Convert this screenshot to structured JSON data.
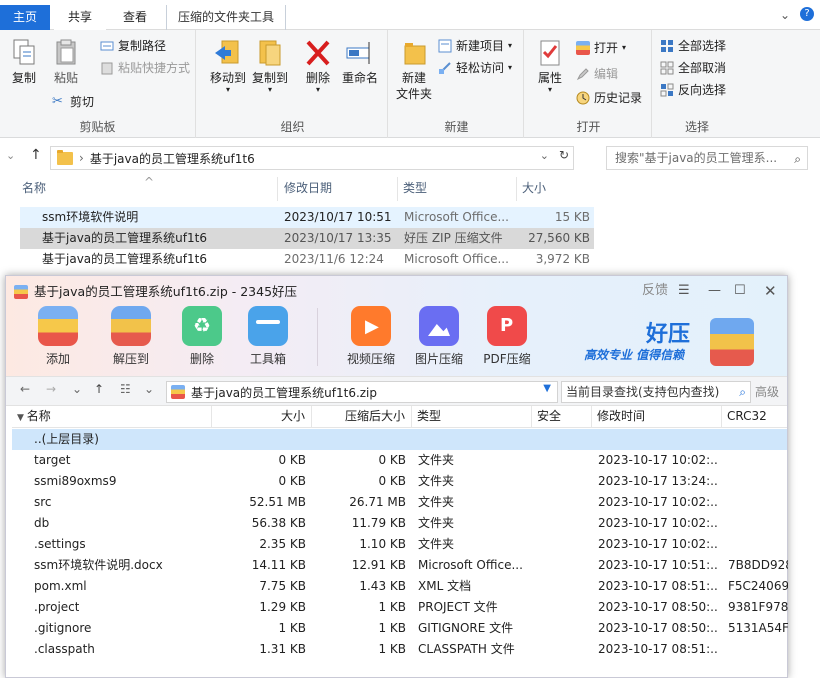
{
  "explorer": {
    "tabs": [
      "主页",
      "共享",
      "查看",
      "压缩的文件夹工具"
    ],
    "clipboard": {
      "copy": "复制",
      "paste": "粘贴",
      "copy_path": "复制路径",
      "paste_shortcut": "粘贴快捷方式",
      "cut": "剪切",
      "group": "剪贴板"
    },
    "organize": {
      "move_to": "移动到",
      "copy_to": "复制到",
      "delete": "删除",
      "rename": "重命名",
      "group": "组织"
    },
    "new": {
      "new_folder_1": "新建",
      "new_folder_2": "文件夹",
      "new_item": "新建项目",
      "easy_access": "轻松访问",
      "group": "新建"
    },
    "open": {
      "properties": "属性",
      "open": "打开",
      "edit": "编辑",
      "history": "历史记录",
      "group": "打开"
    },
    "select": {
      "select_all": "全部选择",
      "select_none": "全部取消",
      "invert": "反向选择",
      "group": "选择"
    },
    "address": {
      "path": "基于java的员工管理系统uf1t6",
      "search_placeholder": "搜索\"基于java的员工管理系..."
    },
    "columns": {
      "name": "名称",
      "modified": "修改日期",
      "type": "类型",
      "size": "大小"
    },
    "files": [
      {
        "name": "ssm环境软件说明",
        "date": "2023/10/17 10:51",
        "type": "Microsoft Office...",
        "size": "15 KB",
        "icon": "word-icon"
      },
      {
        "name": "基于java的员工管理系统uf1t6",
        "date": "2023/10/17 13:35",
        "type": "好压 ZIP 压缩文件",
        "size": "27,560 KB",
        "icon": "zip-icon"
      },
      {
        "name": "基于java的员工管理系统uf1t6",
        "date": "2023/11/6 12:24",
        "type": "Microsoft Office...",
        "size": "3,972 KB",
        "icon": "word-icon"
      }
    ]
  },
  "haozip": {
    "title": "基于java的员工管理系统uf1t6.zip - 2345好压",
    "feedback": "反馈",
    "tools": [
      "添加",
      "解压到",
      "删除",
      "工具箱",
      "视频压缩",
      "图片压缩",
      "PDF压缩"
    ],
    "brand": "好压",
    "slogan": "高效专业  值得信赖",
    "path": "基于java的员工管理系统uf1t6.zip",
    "search_placeholder": "当前目录查找(支持包内查找)",
    "advanced": "高级",
    "columns": {
      "name": "名称",
      "size": "大小",
      "packed": "压缩后大小",
      "type": "类型",
      "security": "安全",
      "modified": "修改时间",
      "crc": "CRC32"
    },
    "rows": [
      {
        "name": "..(上层目录)",
        "size": "",
        "packed": "",
        "type": "",
        "date": "",
        "crc": "",
        "icon": "folder-icon"
      },
      {
        "name": "target",
        "size": "0 KB",
        "packed": "0 KB",
        "type": "文件夹",
        "date": "2023-10-17 10:02:...",
        "crc": "",
        "icon": "folder-icon"
      },
      {
        "name": "ssmi89oxms9",
        "size": "0 KB",
        "packed": "0 KB",
        "type": "文件夹",
        "date": "2023-10-17 13:24:...",
        "crc": "",
        "icon": "folder-icon"
      },
      {
        "name": "src",
        "size": "52.51 MB",
        "packed": "26.71 MB",
        "type": "文件夹",
        "date": "2023-10-17 10:02:...",
        "crc": "",
        "icon": "folder-icon"
      },
      {
        "name": "db",
        "size": "56.38 KB",
        "packed": "11.79 KB",
        "type": "文件夹",
        "date": "2023-10-17 10:02:...",
        "crc": "",
        "icon": "folder-icon"
      },
      {
        "name": ".settings",
        "size": "2.35 KB",
        "packed": "1.10 KB",
        "type": "文件夹",
        "date": "2023-10-17 10:02:...",
        "crc": "",
        "icon": "folder-icon"
      },
      {
        "name": "ssm环境软件说明.docx",
        "size": "14.11 KB",
        "packed": "12.91 KB",
        "type": "Microsoft Office...",
        "date": "2023-10-17 10:51:...",
        "crc": "7B8DD928",
        "icon": "word-icon"
      },
      {
        "name": "pom.xml",
        "size": "7.75 KB",
        "packed": "1.43 KB",
        "type": "XML 文档",
        "date": "2023-10-17 08:51:...",
        "crc": "F5C24069",
        "icon": "file-icon"
      },
      {
        "name": ".project",
        "size": "1.29 KB",
        "packed": "1 KB",
        "type": "PROJECT 文件",
        "date": "2023-10-17 08:50:...",
        "crc": "9381F978",
        "icon": "file-icon"
      },
      {
        "name": ".gitignore",
        "size": "1 KB",
        "packed": "1 KB",
        "type": "GITIGNORE 文件",
        "date": "2023-10-17 08:50:...",
        "crc": "5131A54F",
        "icon": "file-icon"
      },
      {
        "name": ".classpath",
        "size": "1.31 KB",
        "packed": "1 KB",
        "type": "CLASSPATH 文件",
        "date": "2023-10-17 08:51:...",
        "crc": "",
        "icon": "file-icon"
      }
    ]
  },
  "colors": {
    "accent": "#1e6fd9",
    "selection": "#cce8ff",
    "brand_orange": "#ff6a2c"
  }
}
